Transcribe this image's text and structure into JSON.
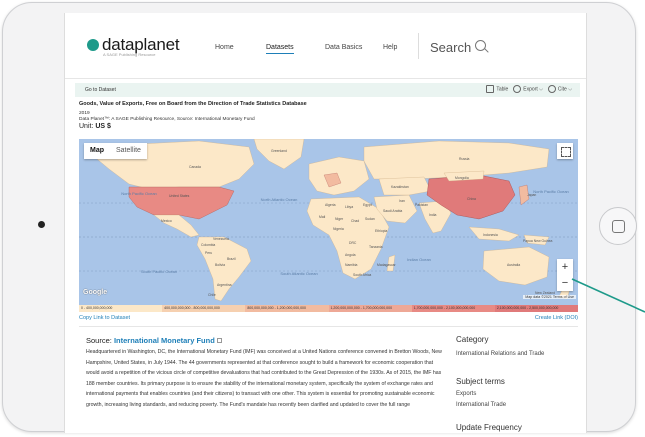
{
  "header": {
    "logo_text": "dataplanet",
    "logo_tagline": "A SAGE Publishing Resource",
    "nav": [
      {
        "label": "Home",
        "active": false
      },
      {
        "label": "Datasets",
        "active": true
      },
      {
        "label": "Data Basics",
        "active": false
      },
      {
        "label": "Help",
        "active": false
      }
    ],
    "search_label": "Search"
  },
  "dataset_bar": {
    "goto_label": "Go to Dataset",
    "table_label": "Table",
    "export_label": "Export",
    "cite_label": "Cite"
  },
  "dataset": {
    "title": "Goods, Value of Exports, Free on Board from the Direction of Trade Statistics Database",
    "year": "2019",
    "source_line": "Data Planet™: A SAGE Publishing Resource, Source: International Monetary Fund",
    "unit_prefix": "Unit:",
    "unit_value": "US $"
  },
  "map": {
    "map_label": "Map",
    "satellite_label": "Satellite",
    "zoom_in": "+",
    "zoom_out": "−",
    "google_label": "Google",
    "attribution": "Map data ©2021  Terms of Use",
    "ocean_labels": {
      "north_pacific_left": "North Pacific Ocean",
      "north_atlantic": "North Atlantic Ocean",
      "north_pacific_right": "North Pacific Ocean",
      "south_pacific": "South Pacific Ocean",
      "south_atlantic": "South Atlantic Ocean",
      "indian": "Indian Ocean"
    },
    "country_labels": {
      "us": "United States",
      "canada": "Canada",
      "greenland": "Greenland",
      "russia": "Russia",
      "china": "China",
      "india": "India",
      "brazil": "Brazil",
      "australia": "Australia",
      "kazakhstan": "Kazakhstan",
      "mexico": "Mexico",
      "peru": "Peru",
      "bolivia": "Bolivia",
      "argentina": "Argentina",
      "chile": "Chile",
      "algeria": "Algeria",
      "libya": "Libya",
      "egypt": "Egypt",
      "mali": "Mali",
      "niger": "Niger",
      "chad": "Chad",
      "sudan": "Sudan",
      "nigeria": "Nigeria",
      "ethiopia": "Ethiopia",
      "drc": "DRC",
      "angola": "Angola",
      "tanzania": "Tanzania",
      "namibia": "Namibia",
      "south_africa": "South Africa",
      "madagascar": "Madagascar",
      "saudi_arabia": "Saudi Arabia",
      "iran": "Iran",
      "pakistan": "Pakistan",
      "mongolia": "Mongolia",
      "japan": "Japan",
      "indonesia": "Indonesia",
      "png": "Papua New Guinea",
      "new_zealand": "New Zealand",
      "venezuela": "Venezuela",
      "colombia": "Colombia"
    }
  },
  "legend": [
    {
      "label": "0 - 400,000,000,000",
      "color": "#fce8c8"
    },
    {
      "label": "400,000,000,000 - 800,000,000,000",
      "color": "#f6d0b0"
    },
    {
      "label": "800,000,000,000 - 1,200,000,000,000",
      "color": "#f2bba0"
    },
    {
      "label": "1,200,000,000,000 - 1,700,000,000,000",
      "color": "#eea896"
    },
    {
      "label": "1,700,000,000,000 - 2,100,000,000,000",
      "color": "#e88a84"
    },
    {
      "label": "2,100,000,000,000 - 2,500,000,000,000",
      "color": "#e07a7a"
    }
  ],
  "links": {
    "copy_link": "Copy Link to Dataset",
    "create_link": "Create Link (DOI)"
  },
  "source": {
    "prefix": "Source:",
    "name": "International Monetary Fund",
    "description": "Headquartered in Washington, DC, the International Monetary Fund (IMF) was conceived at a United Nations conference convened in Bretton Woods, New Hampshire, United States, in July 1944. The 44 governments represented at that conference sought to build a framework for economic cooperation that would avoid a repetition of the vicious circle of competitive devaluations that had contributed to the Great Depression of the 1930s. As of 2015, the IMF has 188 member countries. Its primary purpose is to ensure the stability of the international monetary system, specifically the system of exchange rates and international payments that enables countries (and their citizens) to transact with one other. This system is essential for promoting sustainable economic growth, increasing living standards, and reducing poverty. The Fund's mandate has recently been clarified and updated to cover the full range"
  },
  "sidebar": {
    "category_heading": "Category",
    "category_value": "International Relations and Trade",
    "subject_heading": "Subject terms",
    "subject_terms": [
      "Exports",
      "International Trade"
    ],
    "update_heading": "Update Frequency"
  },
  "colors": {
    "accent": "#1e7fb8",
    "brand": "#1e9a8a",
    "ocean": "#a9c5e8",
    "land": "#fce8c8",
    "china": "#e07a7a",
    "us": "#e88a84",
    "connector": "#1e9a8a"
  }
}
